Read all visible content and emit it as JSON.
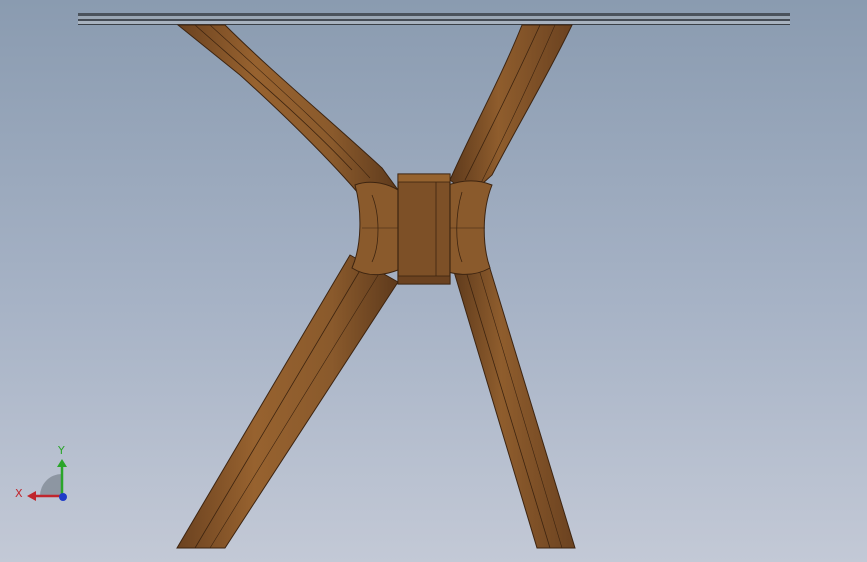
{
  "viewport": {
    "background_top": "#8a9bb0",
    "background_bottom": "#c3c9d6",
    "wood_color": "#8a5a2c",
    "wood_dark": "#6b4220",
    "glass_edge_color": "#3a4048"
  },
  "triad": {
    "x_label": "X",
    "y_label": "Y",
    "x_color": "#c0262d",
    "y_color": "#2aa52a",
    "z_color": "#1f3cc8"
  }
}
